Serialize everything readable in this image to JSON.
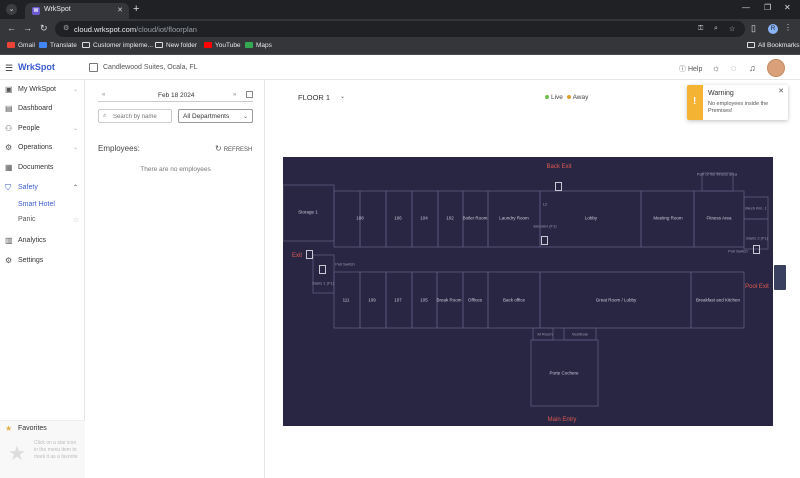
{
  "browser": {
    "tab_title": "WrkSpot",
    "tab_favicon": "W",
    "url_host": "cloud.wrkspot.com",
    "url_path": "/cloud/iot/floorplan",
    "profile_initial": "R",
    "bookmarks": [
      "Gmail",
      "Translate",
      "Customer impleme...",
      "New folder",
      "YouTube",
      "Maps"
    ],
    "all_bookmarks": "All Bookmarks"
  },
  "header": {
    "logo": "WrkSpot",
    "site_name": "Candlewood Suites, Ocala, FL",
    "help": "Help"
  },
  "sidebar": {
    "items": [
      {
        "label": "My WrkSpot",
        "icon": "building-icon"
      },
      {
        "label": "Dashboard",
        "icon": "dashboard-icon"
      },
      {
        "label": "People",
        "icon": "people-icon"
      },
      {
        "label": "Operations",
        "icon": "operations-icon"
      },
      {
        "label": "Documents",
        "icon": "documents-icon"
      },
      {
        "label": "Safety",
        "icon": "shield-icon"
      },
      {
        "label": "Analytics",
        "icon": "analytics-icon"
      },
      {
        "label": "Settings",
        "icon": "gear-icon"
      }
    ],
    "safety_sub": [
      "Smart Hotel",
      "Panic"
    ],
    "favorites_title": "Favorites",
    "favorites_hint": "Click on a star icon in the menu item to mark it as a favorite"
  },
  "employees": {
    "date": "Feb 18 2024",
    "search_placeholder": "Search by name",
    "department": "All Departments",
    "title": "Employees:",
    "refresh": "REFRESH",
    "empty": "There are no employees"
  },
  "floor": {
    "selector": "FLOOR 1",
    "legend_live": "Live",
    "legend_away": "Away",
    "warning_title": "Warning",
    "warning_message": "No employees inside the Premises!",
    "rooms": {
      "storage": "Storage 1",
      "r108": "108",
      "r106": "106",
      "r104": "104",
      "r102": "102",
      "boiler": "Boiler Room",
      "laundry": "Laundry Room",
      "elevator": "Elevator (F1)",
      "l2": "L2",
      "lobby": "Lobby",
      "meeting": "Meeting Room",
      "fitness": "Fitness Area",
      "mech": "Mech Rm. 1",
      "stairs2": "Stairs 2 (F1)",
      "stairs1": "Stairs 1 (F1)",
      "r111": "111",
      "r109": "109",
      "r107": "107",
      "r105": "105",
      "break": "Break Room",
      "offices": "Offices",
      "back_office": "Back office",
      "great_room": "Great Room / Lobby",
      "breakfast": "Breakfast and Kitchen",
      "m_room": "M Room",
      "vestibule": "Vestibule",
      "porte": "Porte Cochere",
      "pull1": "Pull Switch",
      "pull2": "Pull Switch",
      "fitness_part": "Part of the fitness area"
    },
    "exits": {
      "back": "Back Exit",
      "left": "Exit",
      "pool": "Pool Exit",
      "main": "Main Entry"
    }
  }
}
